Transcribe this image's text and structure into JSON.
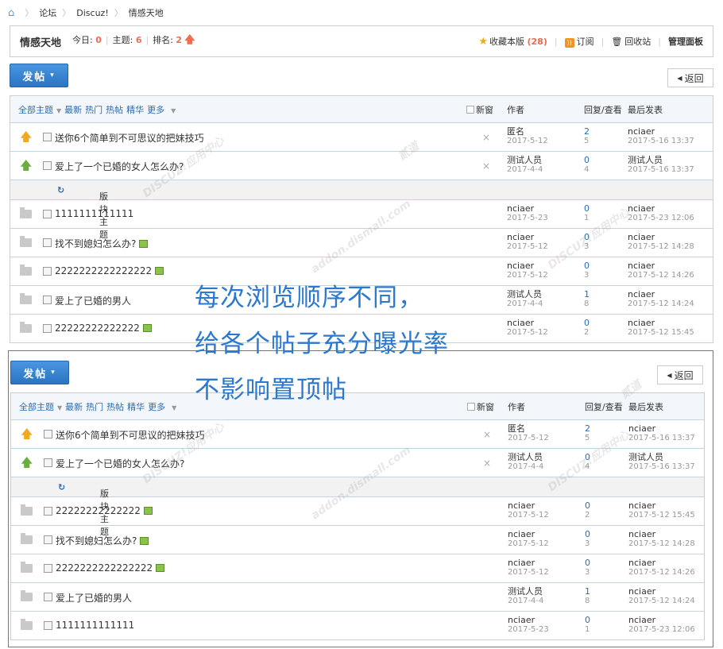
{
  "breadcrumb": {
    "items": [
      "论坛",
      "Discuz!",
      "情感天地"
    ],
    "sep": "〉"
  },
  "forum": {
    "name": "情感天地",
    "today_label": "今日:",
    "today": "0",
    "topics_label": "主题:",
    "topics": "6",
    "rank_label": "排名:",
    "rank": "2",
    "fav_label": "收藏本版",
    "fav_count": "(28)",
    "subscribe": "订阅",
    "recycle": "回收站",
    "admin": "管理面板"
  },
  "toolbar": {
    "post": "发帖",
    "back": "返回"
  },
  "thead": {
    "all": "全部主题",
    "latest": "最新",
    "hot": "热门",
    "hotpost": "热帖",
    "digest": "精华",
    "more": "更多",
    "newwin": "新窗",
    "author": "作者",
    "replies": "回复/查看",
    "lastpost": "最后发表"
  },
  "section_label": "版块主题",
  "panel1": {
    "sticky": [
      {
        "title": "送你6个简单到不可思议的把妹技巧",
        "author": "匿名",
        "date": "2017-5-12",
        "reply": "2",
        "view": "5",
        "last": "nciaer",
        "lastdate": "2017-5-16 13:37"
      },
      {
        "title": "爱上了一个已婚的女人怎么办?",
        "author": "测试人员",
        "date": "2017-4-4",
        "reply": "0",
        "view": "4",
        "last": "测试人员",
        "lastdate": "2017-5-16 13:37"
      }
    ],
    "normal": [
      {
        "title": "1111111111111",
        "author": "nciaer",
        "date": "2017-5-23",
        "reply": "0",
        "view": "1",
        "last": "nciaer",
        "lastdate": "2017-5-23 12:06"
      },
      {
        "title": "找不到媳妇怎么办?",
        "author": "nciaer",
        "date": "2017-5-12",
        "reply": "0",
        "view": "3",
        "last": "nciaer",
        "lastdate": "2017-5-12 14:28"
      },
      {
        "title": "2222222222222222",
        "author": "nciaer",
        "date": "2017-5-12",
        "reply": "0",
        "view": "3",
        "last": "nciaer",
        "lastdate": "2017-5-12 14:26"
      },
      {
        "title": "爱上了已婚的男人",
        "author": "测试人员",
        "date": "2017-4-4",
        "reply": "1",
        "view": "8",
        "last": "nciaer",
        "lastdate": "2017-5-12 14:24"
      },
      {
        "title": "22222222222222",
        "author": "nciaer",
        "date": "2017-5-12",
        "reply": "0",
        "view": "2",
        "last": "nciaer",
        "lastdate": "2017-5-12 15:45"
      }
    ]
  },
  "panel2": {
    "sticky": [
      {
        "title": "送你6个简单到不可思议的把妹技巧",
        "author": "匿名",
        "date": "2017-5-12",
        "reply": "2",
        "view": "5",
        "last": "nciaer",
        "lastdate": "2017-5-16 13:37"
      },
      {
        "title": "爱上了一个已婚的女人怎么办?",
        "author": "测试人员",
        "date": "2017-4-4",
        "reply": "0",
        "view": "4",
        "last": "测试人员",
        "lastdate": "2017-5-16 13:37"
      }
    ],
    "normal": [
      {
        "title": "22222222222222",
        "author": "nciaer",
        "date": "2017-5-12",
        "reply": "0",
        "view": "2",
        "last": "nciaer",
        "lastdate": "2017-5-12 15:45"
      },
      {
        "title": "找不到媳妇怎么办?",
        "author": "nciaer",
        "date": "2017-5-12",
        "reply": "0",
        "view": "3",
        "last": "nciaer",
        "lastdate": "2017-5-12 14:28"
      },
      {
        "title": "2222222222222222",
        "author": "nciaer",
        "date": "2017-5-12",
        "reply": "0",
        "view": "3",
        "last": "nciaer",
        "lastdate": "2017-5-12 14:26"
      },
      {
        "title": "爱上了已婚的男人",
        "author": "测试人员",
        "date": "2017-4-4",
        "reply": "1",
        "view": "8",
        "last": "nciaer",
        "lastdate": "2017-5-12 14:24"
      },
      {
        "title": "1111111111111",
        "author": "nciaer",
        "date": "2017-5-23",
        "reply": "0",
        "view": "1",
        "last": "nciaer",
        "lastdate": "2017-5-23 12:06"
      }
    ]
  },
  "overlay": {
    "line1": "每次浏览顺序不同，",
    "line2": "给各个帖子充分曝光率",
    "line3": "不影响置顶帖"
  },
  "watermark": {
    "text1": "DISCUZ!应用中心",
    "text2": "addon.dismall.com",
    "text3": "贰道"
  },
  "colors": {
    "accent": "#2a78d0",
    "highlight": "#f26c4f",
    "link": "#2a6bb6"
  }
}
